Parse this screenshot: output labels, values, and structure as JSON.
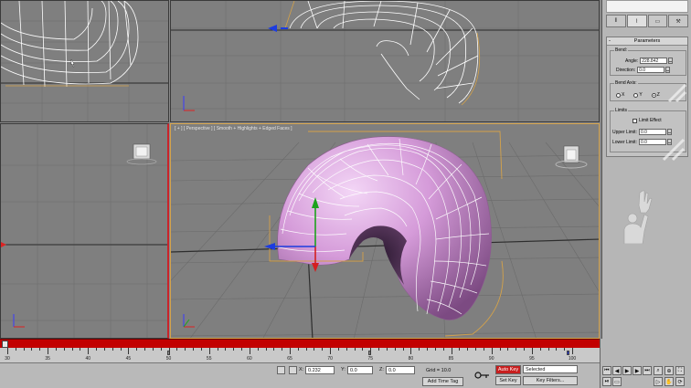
{
  "viewports": {
    "perspective": {
      "label": "[ + ] [ Perspective ] [ Smooth + Highlights + Edged Faces ]"
    }
  },
  "command_panel": {
    "tabs": [
      "hierarchy-icon",
      "motion-icon",
      "display-icon",
      "utilities-icon"
    ],
    "rollout_title": "Parameters",
    "rollout_minus": "-",
    "bend": {
      "group_label": "Bend:",
      "angle_label": "Angle:",
      "angle_value": "228.842",
      "direction_label": "Direction:",
      "direction_value": "0.0"
    },
    "bend_axis": {
      "group_label": "Bend Axis:",
      "options": [
        "X",
        "Y",
        "Z"
      ],
      "selected": "Z"
    },
    "limits": {
      "group_label": "Limits",
      "limit_effect_label": "Limit Effect",
      "upper_label": "Upper Limit:",
      "upper_value": "0.0",
      "lower_label": "Lower Limit:",
      "lower_value": "0.0"
    }
  },
  "timeline": {
    "ticks": [
      "30",
      "35",
      "40",
      "45",
      "50",
      "55",
      "60",
      "65",
      "70",
      "75",
      "80",
      "85",
      "90",
      "95",
      "100"
    ]
  },
  "statusbar": {
    "x_label": "X:",
    "x_value": "0.232",
    "y_label": "Y:",
    "y_value": "0.0",
    "z_label": "Z:",
    "z_value": "0.0",
    "grid_label": "Grid = 10.0",
    "auto_key": "Auto Key",
    "selected": "Selected",
    "set_key": "Set Key",
    "key_filters": "Key Filters...",
    "add_time_tag": "Add Time Tag"
  },
  "colors": {
    "viewport_bg": "#7f7f7f",
    "mesh_fill": "#d7a3dc",
    "wire": "#ffffff",
    "selection": "#d4a24a",
    "timeslider": "#c20000",
    "auto_key": "#c81e1e"
  }
}
